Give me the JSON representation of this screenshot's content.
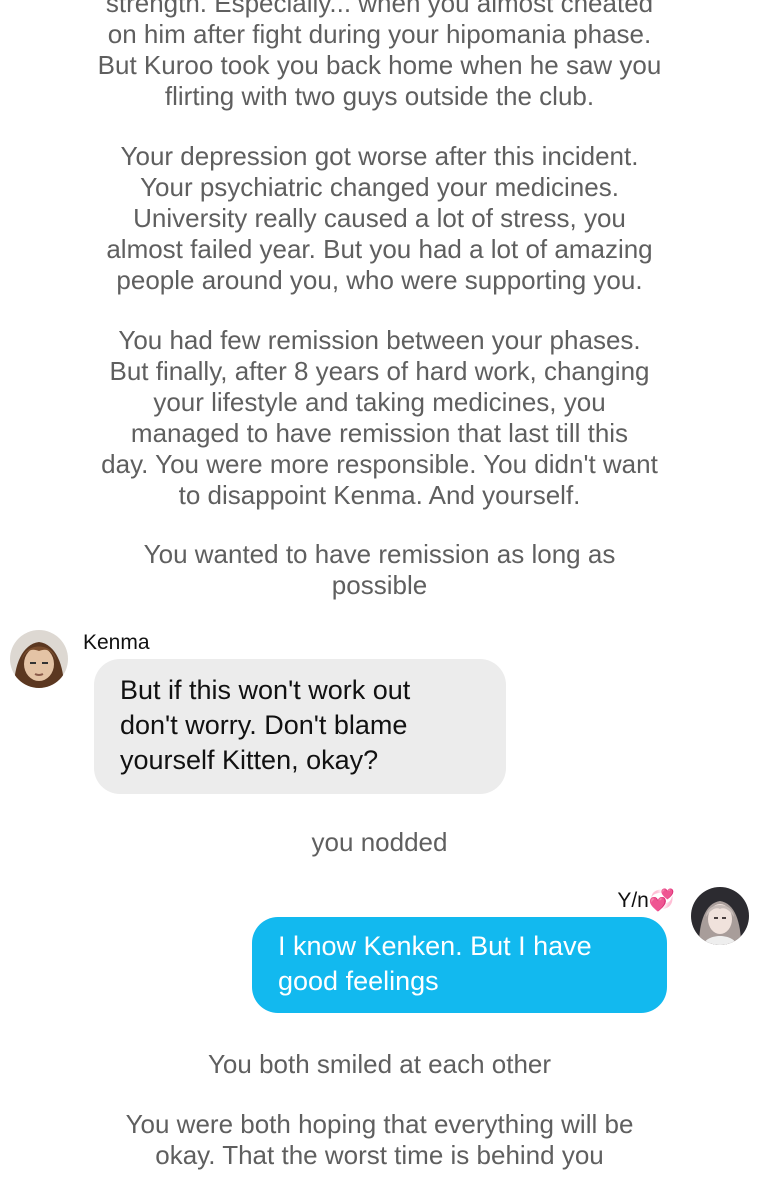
{
  "narration_blocks": [
    "strength. Especially... when you almost cheated\non him after fight during your hipomania phase.\nBut Kuroo took you back home when he saw you\nflirting with two guys outside the club.",
    "Your depression got worse after this incident.\nYour psychiatric changed your medicines.\nUniversity really caused a lot of stress, you\nalmost failed year. But you had a lot of amazing\npeople around you, who were supporting you.",
    "You had few remission between your phases.\nBut finally, after 8 years of hard work, changing\nyour lifestyle and taking medicines, you\nmanaged to have remission that last till this\nday. You were more responsible. You didn't want\nto disappoint Kenma. And yourself.",
    "You wanted to have remission as long as\npossible",
    "you nodded",
    "You both smiled at each other",
    "You were both hoping that everything will be\nokay. That the worst time is behind you"
  ],
  "messages": [
    {
      "sender": "Kenma",
      "text": "But if this won't work out\ndon't worry. Don't blame\nyourself Kitten, okay?"
    },
    {
      "sender": "Y/n💞",
      "text": "I know Kenken. But I have\ngood feelings"
    }
  ],
  "colors": {
    "incoming_bubble": "#ececec",
    "outgoing_bubble": "#12b9ef",
    "narration_text": "#5f5f5f"
  }
}
